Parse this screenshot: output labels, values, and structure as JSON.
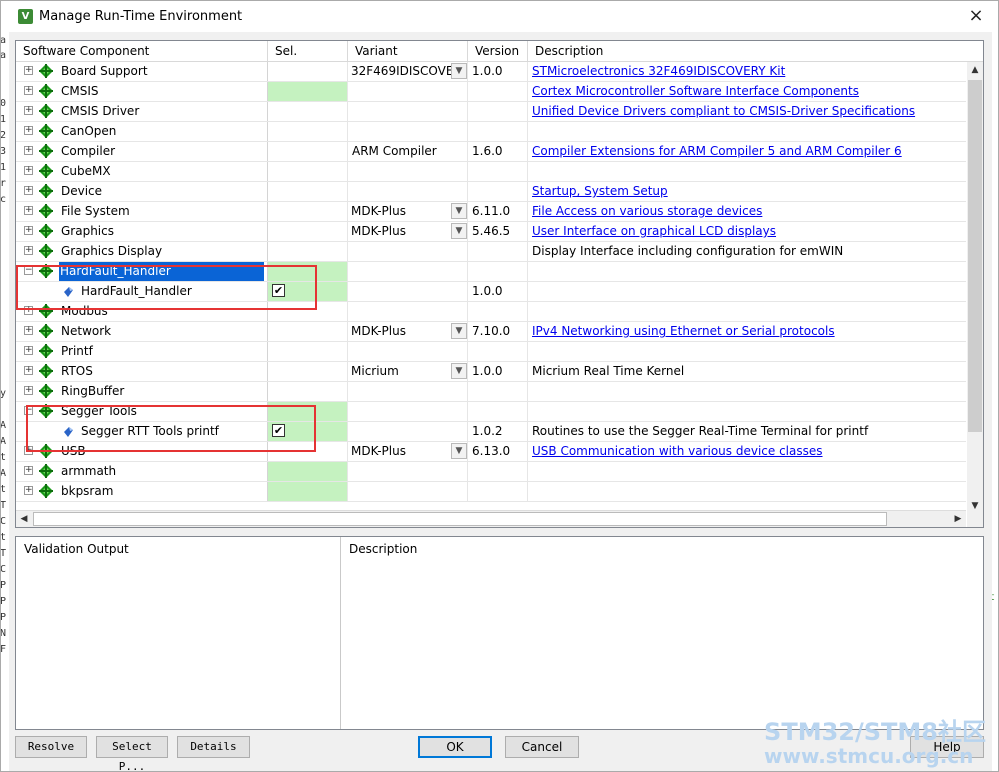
{
  "window": {
    "title": "Manage Run-Time Environment",
    "icon_letter": "V",
    "close": "×"
  },
  "columns": [
    "Software Component",
    "Sel.",
    "Variant",
    "Version",
    "Description"
  ],
  "rows": [
    {
      "name": "Board Support",
      "expander": "+",
      "type": "group",
      "sel": "",
      "green": false,
      "variant": "32F469IDISCOVERY",
      "combo": true,
      "version": "1.0.0",
      "desc": "STMicroelectronics 32F469IDISCOVERY Kit",
      "link": true
    },
    {
      "name": "CMSIS",
      "expander": "+",
      "type": "group",
      "sel": "",
      "green": true,
      "variant": "",
      "combo": false,
      "version": "",
      "desc": "Cortex Microcontroller Software Interface Components",
      "link": true
    },
    {
      "name": "CMSIS Driver",
      "expander": "+",
      "type": "group",
      "sel": "",
      "green": false,
      "variant": "",
      "combo": false,
      "version": "",
      "desc": "Unified Device Drivers compliant to CMSIS-Driver Specifications",
      "link": true
    },
    {
      "name": "CanOpen",
      "expander": "+",
      "type": "group",
      "sel": "",
      "green": false,
      "variant": "",
      "combo": false,
      "version": "",
      "desc": "",
      "link": false
    },
    {
      "name": "Compiler",
      "expander": "+",
      "type": "group",
      "sel": "",
      "green": false,
      "variant": "ARM Compiler",
      "combo": false,
      "version": "1.6.0",
      "desc": "Compiler Extensions for ARM Compiler 5 and ARM Compiler 6",
      "link": true
    },
    {
      "name": "CubeMX",
      "expander": "+",
      "type": "group",
      "sel": "",
      "green": false,
      "variant": "",
      "combo": false,
      "version": "",
      "desc": "",
      "link": false
    },
    {
      "name": "Device",
      "expander": "+",
      "type": "group",
      "sel": "",
      "green": false,
      "variant": "",
      "combo": false,
      "version": "",
      "desc": "Startup, System Setup",
      "link": true
    },
    {
      "name": "File System",
      "expander": "+",
      "type": "group",
      "sel": "",
      "green": false,
      "variant": "MDK-Plus",
      "combo": true,
      "version": "6.11.0",
      "desc": "File Access on various storage devices",
      "link": true
    },
    {
      "name": "Graphics",
      "expander": "+",
      "type": "group",
      "sel": "",
      "green": false,
      "variant": "MDK-Plus",
      "combo": true,
      "version": "5.46.5",
      "desc": "User Interface on graphical LCD displays",
      "link": true
    },
    {
      "name": "Graphics Display",
      "expander": "+",
      "type": "group",
      "sel": "",
      "green": false,
      "variant": "",
      "combo": false,
      "version": "",
      "desc": "Display Interface including configuration for emWIN",
      "link": false
    },
    {
      "name": "HardFault_Handler",
      "expander": "−",
      "type": "group",
      "selected": true,
      "sel": "",
      "green": true,
      "variant": "",
      "combo": false,
      "version": "",
      "desc": "",
      "link": false
    },
    {
      "name": "HardFault_Handler",
      "expander": "",
      "type": "sub",
      "sel": "✔",
      "green": true,
      "variant": "",
      "combo": false,
      "version": "1.0.0",
      "desc": "",
      "link": false
    },
    {
      "name": "Modbus",
      "expander": "+",
      "type": "group",
      "sel": "",
      "green": false,
      "variant": "",
      "combo": false,
      "version": "",
      "desc": "",
      "link": false
    },
    {
      "name": "Network",
      "expander": "+",
      "type": "group",
      "sel": "",
      "green": false,
      "variant": "MDK-Plus",
      "combo": true,
      "version": "7.10.0",
      "desc": "IPv4 Networking using Ethernet or Serial protocols",
      "link": true
    },
    {
      "name": "Printf",
      "expander": "+",
      "type": "group",
      "sel": "",
      "green": false,
      "variant": "",
      "combo": false,
      "version": "",
      "desc": "",
      "link": false
    },
    {
      "name": "RTOS",
      "expander": "+",
      "type": "group",
      "sel": "",
      "green": false,
      "variant": "Micrium",
      "combo": true,
      "version": "1.0.0",
      "desc": "Micrium Real Time Kernel",
      "link": false
    },
    {
      "name": "RingBuffer",
      "expander": "+",
      "type": "group",
      "sel": "",
      "green": false,
      "variant": "",
      "combo": false,
      "version": "",
      "desc": "",
      "link": false
    },
    {
      "name": "Segger Tools",
      "expander": "−",
      "type": "group",
      "sel": "",
      "green": true,
      "variant": "",
      "combo": false,
      "version": "",
      "desc": "",
      "link": false
    },
    {
      "name": "Segger RTT Tools printf",
      "expander": "",
      "type": "sub",
      "sel": "✔",
      "green": true,
      "variant": "",
      "combo": false,
      "version": "1.0.2",
      "desc": "Routines to use the Segger Real-Time Terminal for printf",
      "link": false
    },
    {
      "name": "USB",
      "expander": "+",
      "type": "group",
      "sel": "",
      "green": false,
      "variant": "MDK-Plus",
      "combo": true,
      "version": "6.13.0",
      "desc": "USB Communication with various device classes",
      "link": true
    },
    {
      "name": "armmath",
      "expander": "+",
      "type": "group",
      "sel": "",
      "green": true,
      "variant": "",
      "combo": false,
      "version": "",
      "desc": "",
      "link": false
    },
    {
      "name": "bkpsram",
      "expander": "+",
      "type": "group",
      "sel": "",
      "green": true,
      "variant": "",
      "combo": false,
      "version": "",
      "desc": "",
      "link": false
    }
  ],
  "validation": {
    "col1": "Validation Output",
    "col2": "Description"
  },
  "buttons": {
    "resolve": "Resolve",
    "select_packs": "Select P...",
    "details": "Details",
    "ok": "OK",
    "cancel": "Cancel",
    "help": "Help"
  },
  "watermark": {
    "line1": "STM32/STM8社区",
    "line2": "www.stmcu.org.cn"
  },
  "left_strip_chars": [
    "a",
    "a",
    "0",
    "1",
    "2",
    "3",
    "1",
    "r",
    "c",
    "y",
    "A",
    "A",
    "t",
    "A",
    "t",
    "T",
    "C",
    "t",
    "T",
    "C",
    "P",
    "P",
    "P",
    "N",
    "F"
  ],
  "right_strip_char": "t"
}
